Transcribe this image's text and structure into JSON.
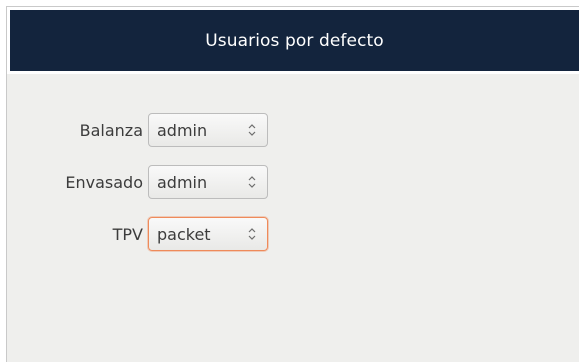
{
  "dialog": {
    "title": "Usuarios por defecto"
  },
  "fields": [
    {
      "label": "Balanza",
      "value": "admin",
      "focused": false
    },
    {
      "label": "Envasado",
      "value": "admin",
      "focused": false
    },
    {
      "label": "TPV",
      "value": "packet",
      "focused": true
    }
  ],
  "colors": {
    "header_bg": "#13243d",
    "focus_border": "#ef8a5a"
  },
  "icons": {
    "combo_arrow": "up-down-spin-icon"
  }
}
